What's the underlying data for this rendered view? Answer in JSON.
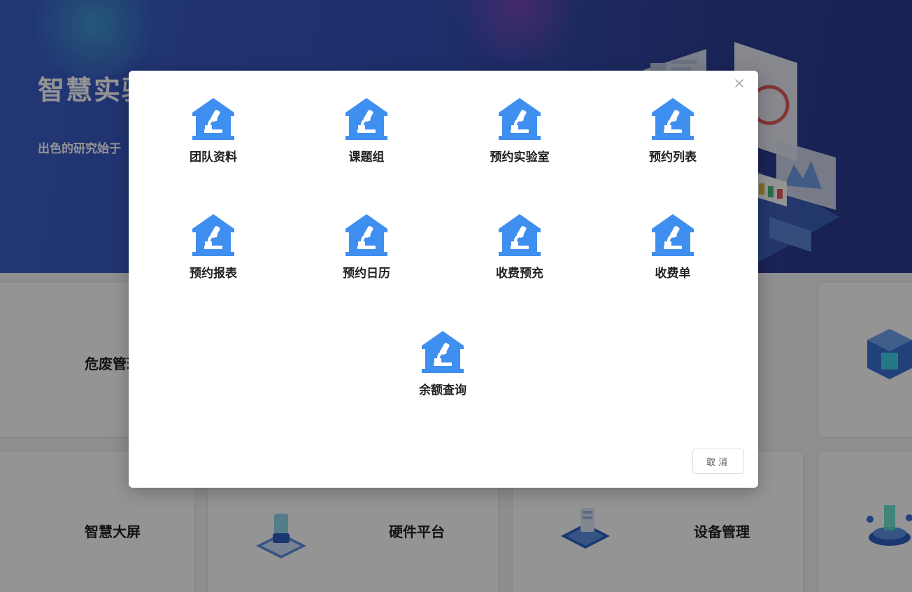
{
  "hero": {
    "title": "智慧实验",
    "subtitle": "出色的研究始于"
  },
  "background_cards": [
    {
      "label": "危废管理"
    },
    {
      "label": "智慧大屏"
    },
    {
      "label": "硬件平台"
    },
    {
      "label": "设备管理"
    }
  ],
  "modal": {
    "tiles": [
      {
        "label": "团队资料"
      },
      {
        "label": "课题组"
      },
      {
        "label": "预约实验室"
      },
      {
        "label": "预约列表"
      },
      {
        "label": "预约报表"
      },
      {
        "label": "预约日历"
      },
      {
        "label": "收费预充"
      },
      {
        "label": "收费单"
      },
      {
        "label": "余额查询"
      }
    ],
    "cancel_label": "取消"
  },
  "colors": {
    "accent_blue": "#3f8ff0",
    "hero_blue": "#3552b8",
    "overlay": "rgba(0,0,0,0.42)"
  },
  "icons": {
    "tile_icon": "lab-microscope-icon",
    "close": "close-icon"
  }
}
